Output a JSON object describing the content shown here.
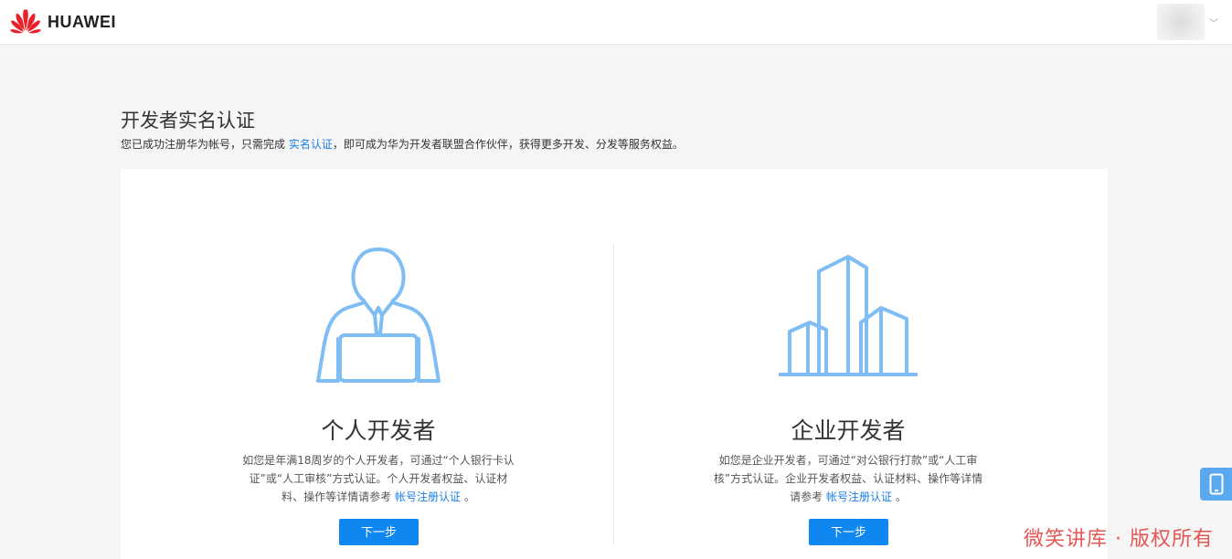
{
  "header": {
    "brand": "HUAWEI",
    "logo_icon": "huawei-flower-icon",
    "avatar_icon": "user-avatar",
    "dropdown_icon": "chevron-down-icon",
    "dropdown_glyph": "﹀"
  },
  "page": {
    "title": "开发者实名认证",
    "intro_before": "您已成功注册华为帐号，只需完成 ",
    "intro_link": "实名认证",
    "intro_after": "，即可成为华为开发者联盟合作伙伴，获得更多开发、分发等服务权益。"
  },
  "cards": {
    "personal": {
      "icon": "person-laptop-icon",
      "title": "个人开发者",
      "desc": "如您是年满18周岁的个人开发者，可通过“个人银行卡认证”或“人工审核”方式认证。个人开发者权益、认证材料、操作等详情请参考 ",
      "link": "帐号注册认证",
      "desc_end": " 。",
      "button": "下一步"
    },
    "enterprise": {
      "icon": "buildings-icon",
      "title": "企业开发者",
      "desc": "如您是企业开发者，可通过“对公银行打款”或“人工审核”方式认证。企业开发者权益、认证材料、操作等详情请参考 ",
      "link": "帐号注册认证",
      "desc_end": " 。",
      "button": "下一步"
    }
  },
  "sidebar": {
    "mobile_icon": "mobile-phone-icon"
  },
  "watermark": "微笑讲库 · 版权所有",
  "colors": {
    "accent": "#0f87f0",
    "link": "#1d7fe8",
    "illustration": "#7fbdf5",
    "background": "#f5f5f5",
    "brand_red": "#e8202a"
  }
}
